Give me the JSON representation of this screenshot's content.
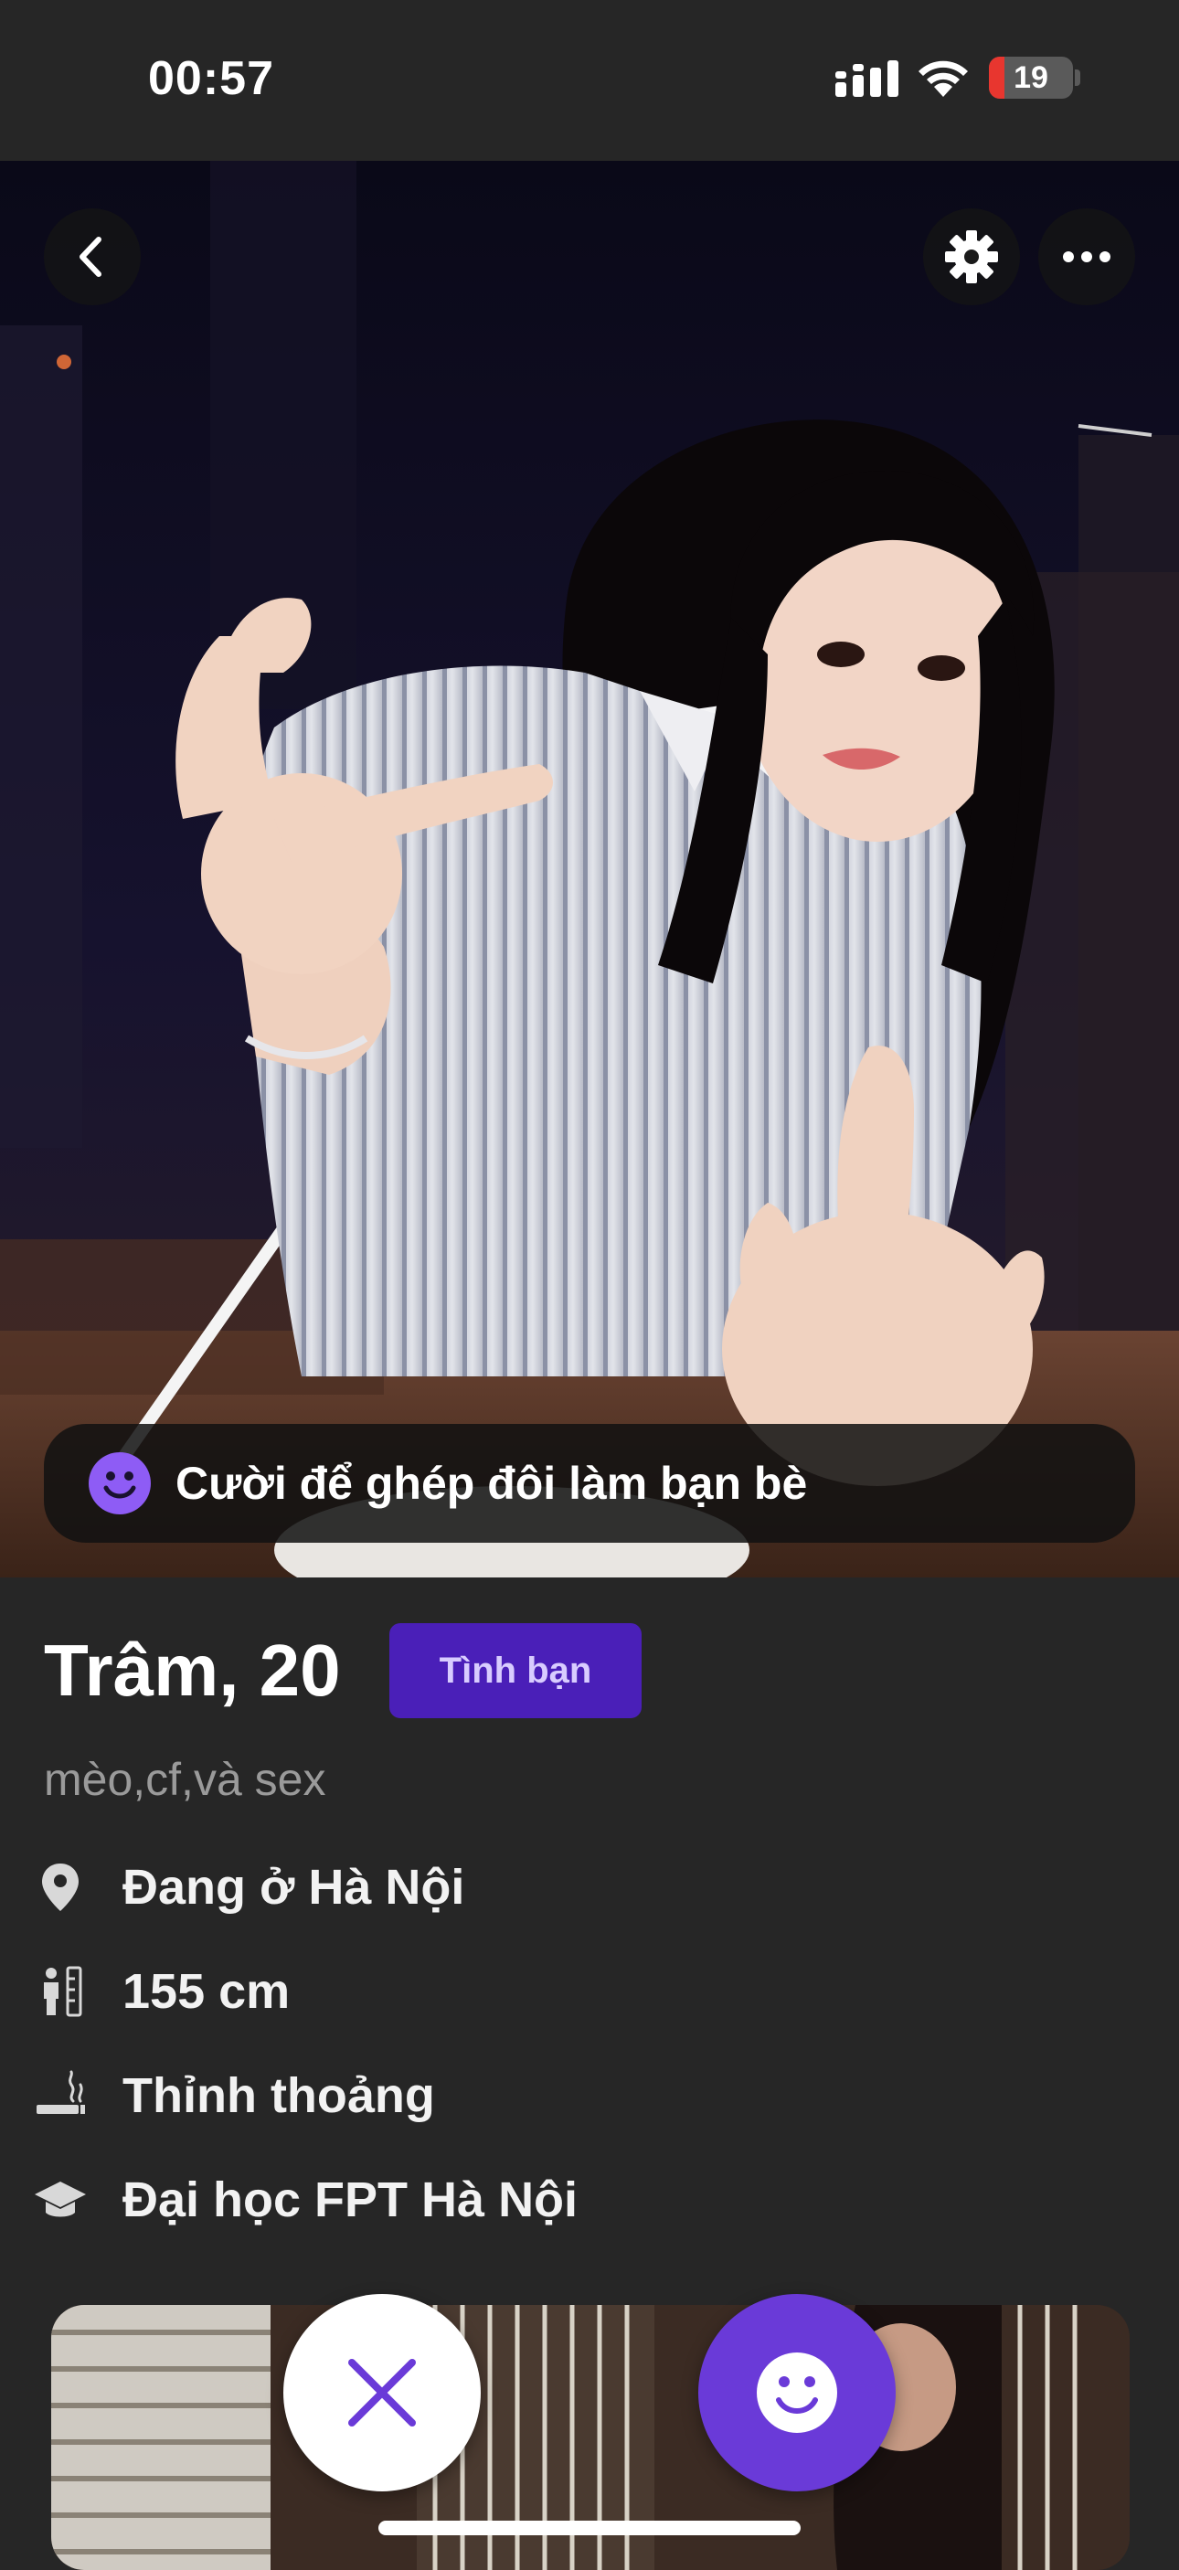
{
  "status_bar": {
    "time": "00:57",
    "battery_level": 19,
    "battery_label": "19",
    "icons": [
      "cellular-signal-icon",
      "wifi-icon",
      "battery-icon"
    ]
  },
  "photo": {
    "buttons": [
      "back-icon",
      "gear-icon",
      "more-dots-icon"
    ],
    "prompt": "Cười để ghép đôi làm bạn bè",
    "prompt_icon": "smiley-icon"
  },
  "profile": {
    "name_age": "Trâm, 20",
    "badge": "Tình bạn",
    "bio": "mèo,cf,và sex",
    "details": {
      "location": "Đang ở Hà Nội",
      "height": "155 cm",
      "smoking": "Thỉnh thoảng",
      "education": "Đại học FPT Hà Nội"
    }
  },
  "actions": {
    "pass_icon": "close-x-icon",
    "like_icon": "smiley-icon"
  },
  "colors": {
    "background": "#262626",
    "accent": "#6a3ad8",
    "badge_bg": "#4a1fb8",
    "battery_low": "#e8362f"
  }
}
